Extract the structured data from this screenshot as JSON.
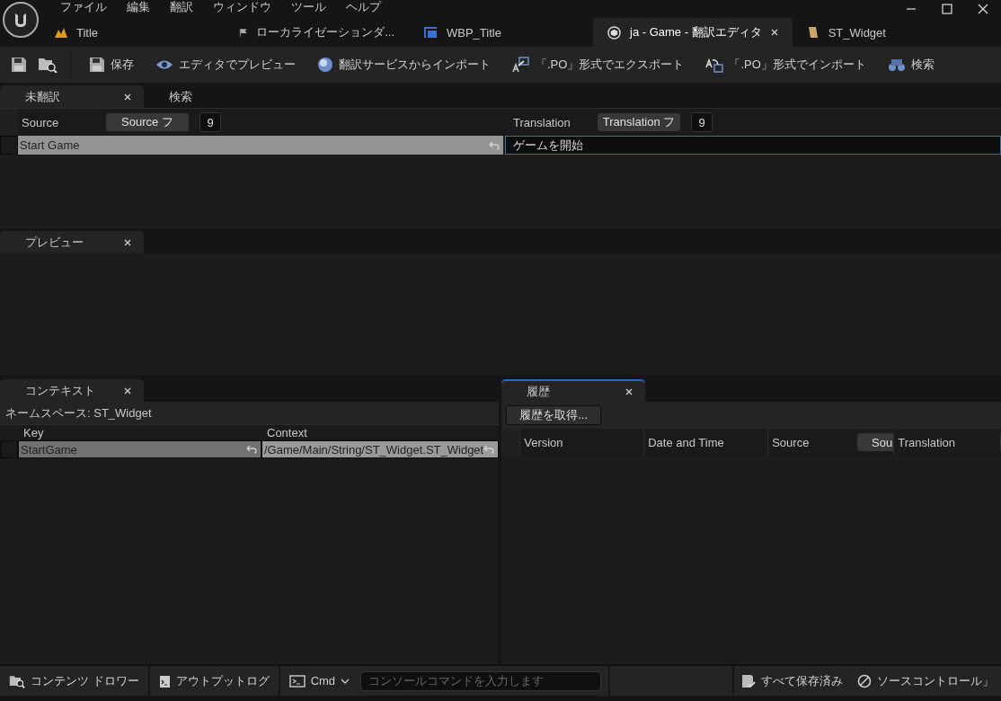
{
  "menu": [
    "ファイル",
    "編集",
    "翻訳",
    "ウィンドウ",
    "ツール",
    "ヘルプ"
  ],
  "doc_tabs": [
    {
      "label": "Title",
      "kind": "level",
      "selected": false,
      "closable": false
    },
    {
      "label": "ローカライゼーションダ...",
      "kind": "flag",
      "selected": false,
      "closable": false
    },
    {
      "label": "WBP_Title",
      "kind": "widget",
      "selected": false,
      "closable": false
    },
    {
      "label": "ja - Game - 翻訳エディタ",
      "kind": "translation",
      "selected": true,
      "closable": true
    },
    {
      "label": "ST_Widget",
      "kind": "table",
      "selected": false,
      "closable": false
    }
  ],
  "toolbar": [
    {
      "kind": "save"
    },
    {
      "kind": "browse"
    },
    {
      "kind": "save",
      "label": "保存"
    },
    {
      "kind": "eye",
      "label": "エディタでプレビュー"
    },
    {
      "kind": "globe",
      "label": "翻訳サービスからインポート"
    },
    {
      "kind": "export",
      "label": "「.PO」形式でエクスポート"
    },
    {
      "kind": "import",
      "label": "「.PO」形式でインポート"
    },
    {
      "kind": "binoculars",
      "label": "検索"
    }
  ],
  "untranslated": {
    "tabs": [
      {
        "label": "未翻訳",
        "selected": true,
        "closable": true
      },
      {
        "label": "検索",
        "selected": false,
        "closable": false
      }
    ],
    "columns": [
      {
        "label": "Source",
        "filter": "Source フ",
        "count": "9"
      },
      {
        "label": "Translation",
        "filter": "Translation フ",
        "count": "9"
      }
    ],
    "rows": [
      {
        "source": "Start Game",
        "translation": "ゲームを開始",
        "selected": true
      }
    ]
  },
  "preview": {
    "tab": "プレビュー"
  },
  "context": {
    "tab": "コンテキスト",
    "namespace": "ネームスペース: ST_Widget",
    "columns": [
      "Key",
      "Context"
    ],
    "rows": [
      {
        "key": "StartGame",
        "context": "/Game/Main/String/ST_Widget.ST_Widget",
        "selected": true
      }
    ]
  },
  "history": {
    "tab": "履歴",
    "button": "履歴を取得...",
    "columns": [
      {
        "label": "Version",
        "kind": "plain"
      },
      {
        "label": "Date and Time",
        "kind": "plain"
      },
      {
        "label": "Source",
        "kind": "filtered",
        "filter": "Sou"
      },
      {
        "label": "Translation",
        "kind": "filtered"
      }
    ]
  },
  "status_bar": {
    "left": [
      {
        "kind": "drawer",
        "label": "コンテンツ ドロワー"
      },
      {
        "kind": "log",
        "label": "アウトプットログ"
      }
    ],
    "cmd": "Cmd",
    "console_placeholder": "コンソールコマンドを入力します",
    "right": [
      {
        "kind": "saved",
        "label": "すべて保存済み"
      },
      {
        "kind": "source",
        "label": "ソースコントロール」"
      }
    ]
  }
}
